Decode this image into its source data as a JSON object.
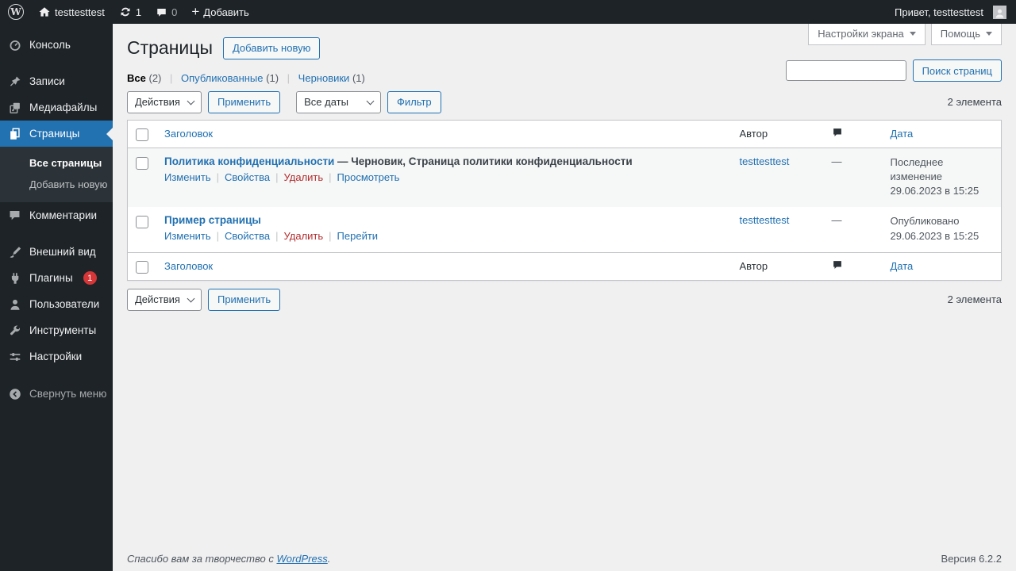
{
  "colors": {
    "admin_bar_bg": "#1d2327",
    "accent": "#2271b1",
    "badge": "#d63638",
    "delete_link": "#b32d2e",
    "content_bg": "#f0f0f1",
    "stripe_row": "#f6f7f7",
    "border": "#c3c4c7"
  },
  "admin_bar": {
    "site_name": "testtesttest",
    "updates_count": "1",
    "comments_count": "0",
    "new_label": "Добавить",
    "greeting": "Привет, testtesttest"
  },
  "sidebar": {
    "items": [
      {
        "label": "Консоль",
        "icon": "dashboard-icon"
      },
      {
        "label": "Записи",
        "icon": "pin-icon"
      },
      {
        "label": "Медиафайлы",
        "icon": "media-icon"
      },
      {
        "label": "Страницы",
        "icon": "pages-icon"
      },
      {
        "label": "Комментарии",
        "icon": "comments-icon"
      },
      {
        "label": "Внешний вид",
        "icon": "appearance-icon"
      },
      {
        "label": "Плагины",
        "icon": "plugins-icon",
        "badge": "1"
      },
      {
        "label": "Пользователи",
        "icon": "users-icon"
      },
      {
        "label": "Инструменты",
        "icon": "tools-icon"
      },
      {
        "label": "Настройки",
        "icon": "settings-icon"
      },
      {
        "label": "Свернуть меню",
        "icon": "collapse-icon"
      }
    ],
    "submenu": [
      "Все страницы",
      "Добавить новую"
    ]
  },
  "screen_meta": {
    "screen_options": "Настройки экрана",
    "help": "Помощь"
  },
  "page": {
    "title": "Страницы",
    "add_new": "Добавить новую"
  },
  "search": {
    "value": "",
    "button": "Поиск страниц"
  },
  "filters": {
    "all": "Все",
    "all_count": "(2)",
    "published": "Опубликованные",
    "published_count": "(1)",
    "drafts": "Черновики",
    "drafts_count": "(1)"
  },
  "bulk": {
    "actions_label": "Действия",
    "apply": "Применить",
    "dates_label": "Все даты",
    "filter": "Фильтр",
    "items_count": "2 элемента"
  },
  "table": {
    "columns": {
      "title": "Заголовок",
      "author": "Автор",
      "date": "Дата"
    },
    "rows": [
      {
        "title": "Политика конфиденциальности",
        "suffix": "— Черновик, Страница политики конфиденциальности",
        "author": "testtesttest",
        "comments": "—",
        "date_line1": "Последнее изменение",
        "date_line2": "29.06.2023 в 15:25",
        "actions": [
          "Изменить",
          "Свойства",
          "Удалить",
          "Просмотреть"
        ]
      },
      {
        "title": "Пример страницы",
        "suffix": "",
        "author": "testtesttest",
        "comments": "—",
        "date_line1": "Опубликовано",
        "date_line2": "29.06.2023 в 15:25",
        "actions": [
          "Изменить",
          "Свойства",
          "Удалить",
          "Перейти"
        ]
      }
    ]
  },
  "footer": {
    "thanks_prefix": "Спасибо вам за творчество с ",
    "wordpress_link": "WordPress",
    "thanks_suffix": ".",
    "version": "Версия 6.2.2"
  }
}
